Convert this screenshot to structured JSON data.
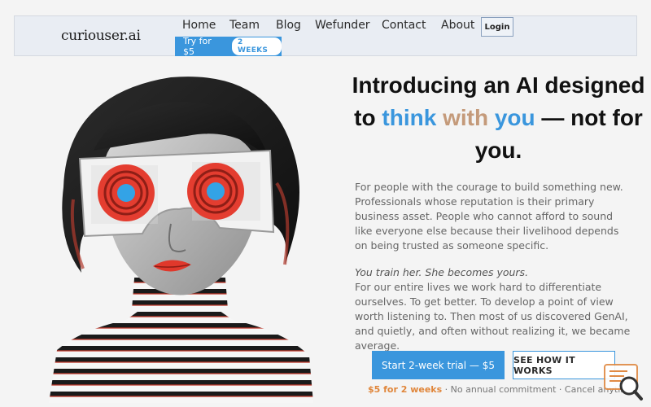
{
  "brand": {
    "logo_text": "curiouser.ai"
  },
  "nav": {
    "items": [
      "Home",
      "Team",
      "Blog",
      "Wefunder",
      "Contact",
      "About"
    ],
    "login_label": "Login",
    "trial_label": "Try for $5",
    "trial_badge": "2 WEEKS"
  },
  "hero": {
    "headline_pre": "Introducing an AI designed",
    "headline_to": "to",
    "headline_think": "think",
    "headline_with": "with",
    "headline_you": "you",
    "headline_post": "— not for you.",
    "para1": "For people with the courage to build something new. Professionals whose reputation is their primary business asset. People who cannot afford to sound like everyone else because their livelihood depends on being trusted as someone specific.",
    "para2_lead": "You train her. She becomes yours.",
    "para2_body": "For our entire lives we work hard to differentiate ourselves. To get better. To develop a point of view worth listening to. Then most of us discovered GenAI, and quietly, and often without realizing it, we became average.",
    "cta_primary": "Start 2-week trial — $5",
    "cta_secondary": "SEE HOW IT WORKS",
    "promo_accent": "$5 for 2 weeks",
    "promo_rest": " · No annual commitment · Cancel anytime"
  },
  "colors": {
    "accent": "#3a96dd",
    "warm": "#c49a7a",
    "promo": "#e0863b"
  },
  "icons": {
    "corner": "search-chat-icon"
  }
}
